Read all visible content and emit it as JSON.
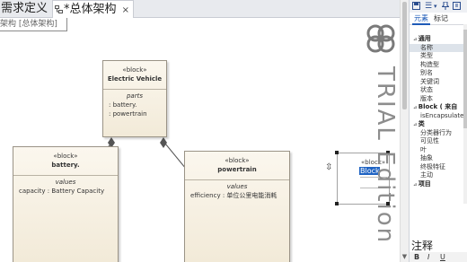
{
  "tabs": [
    {
      "label": "需求定义",
      "close": "×"
    },
    {
      "label": "*总体架构",
      "close": "×"
    }
  ],
  "diagram_frame_label": "架构 [总体架构]",
  "blocks": {
    "electric_vehicle": {
      "stereotype": "«block»",
      "name": "Electric Vehicle",
      "compartment": "parts",
      "items": [
        ": battery.",
        ": powertrain"
      ]
    },
    "battery": {
      "stereotype": "«block»",
      "name": "battery.",
      "compartment": "values",
      "items": [
        "capacity : Battery Capacity"
      ]
    },
    "powertrain": {
      "stereotype": "«block»",
      "name": "powertrain",
      "compartment": "values",
      "items": [
        "efficiency : 单位公里电能消耗"
      ]
    },
    "new_block": {
      "stereotype": "«block»",
      "name_editing": "Block1"
    }
  },
  "watermark": "TRIAL Edition",
  "right_panel": {
    "toolbar_glyph": "☰",
    "tabs": [
      "元素",
      "标记"
    ],
    "rows": [
      {
        "text": "通用",
        "kind": "section"
      },
      {
        "text": "名称",
        "kind": "item",
        "selected": true
      },
      {
        "text": "类型",
        "kind": "item"
      },
      {
        "text": "构造型",
        "kind": "item"
      },
      {
        "text": "别名",
        "kind": "item"
      },
      {
        "text": "关键词",
        "kind": "item"
      },
      {
        "text": "状态",
        "kind": "item"
      },
      {
        "text": "版本",
        "kind": "item"
      },
      {
        "text": "Block ( 来自",
        "kind": "section"
      },
      {
        "text": "isEncapsulated",
        "kind": "item"
      },
      {
        "text": "类",
        "kind": "section"
      },
      {
        "text": "分类器行为",
        "kind": "item"
      },
      {
        "text": "可见性",
        "kind": "item"
      },
      {
        "text": "叶",
        "kind": "item"
      },
      {
        "text": "抽象",
        "kind": "item"
      },
      {
        "text": "终极特征",
        "kind": "item"
      },
      {
        "text": "主动",
        "kind": "item"
      },
      {
        "text": "项目",
        "kind": "section"
      }
    ],
    "notes_title": "注释",
    "notes_toolbar": [
      "B",
      "I",
      "U"
    ]
  }
}
